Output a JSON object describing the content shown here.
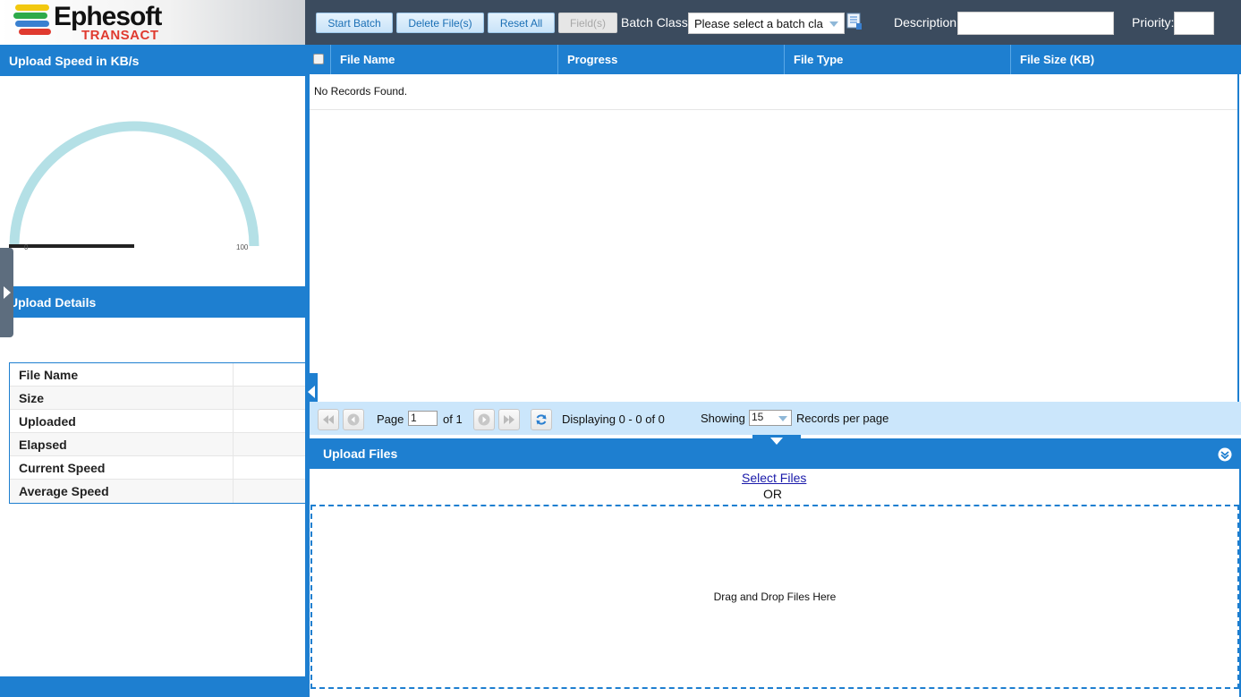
{
  "logo": {
    "word": "Ephesoft",
    "sub": "TRANSACT",
    "stripe_colors": [
      "#f2c80f",
      "#2eaa4a",
      "#3a80d0",
      "#e03a2f"
    ]
  },
  "toolbar": {
    "start_batch": "Start Batch",
    "delete_files": "Delete File(s)",
    "reset_all": "Reset All",
    "fields": "Field(s)",
    "batch_class_label": "Batch Class:",
    "batch_class_value": "Please select a batch cla",
    "description_label": "Description:",
    "description_value": "",
    "priority_label": "Priority:",
    "priority_value": ""
  },
  "speed_panel": {
    "title": "Upload Speed in KB/s",
    "gauge": {
      "min_label": "0",
      "max_label": "100",
      "value": 0,
      "min": 0,
      "max": 100,
      "track_color": "#b4e0e6",
      "needle_color": "#222222"
    }
  },
  "details_panel": {
    "title": "Upload Details",
    "rows": [
      {
        "label": "File Name",
        "value": ""
      },
      {
        "label": "Size",
        "value": ""
      },
      {
        "label": "Uploaded",
        "value": ""
      },
      {
        "label": "Elapsed",
        "value": ""
      },
      {
        "label": "Current Speed",
        "value": ""
      },
      {
        "label": "Average Speed",
        "value": ""
      }
    ]
  },
  "grid": {
    "columns": [
      "File Name",
      "Progress",
      "File Type",
      "File Size (KB)"
    ],
    "empty_text": "No Records Found."
  },
  "pager": {
    "page_label": "Page",
    "page_value": "1",
    "of_label": "of 1",
    "displaying": "Displaying 0 - 0 of 0",
    "showing_label": "Showing",
    "per_page_value": "15",
    "records_label": "Records per page"
  },
  "upload": {
    "title": "Upload Files",
    "select_files": "Select Files",
    "or": "OR",
    "drop_text": "Drag and Drop Files Here"
  },
  "colors": {
    "accent": "#1e7fd0",
    "header_bg": "#3b4b5e",
    "pager_bg": "#cbe6fb"
  }
}
